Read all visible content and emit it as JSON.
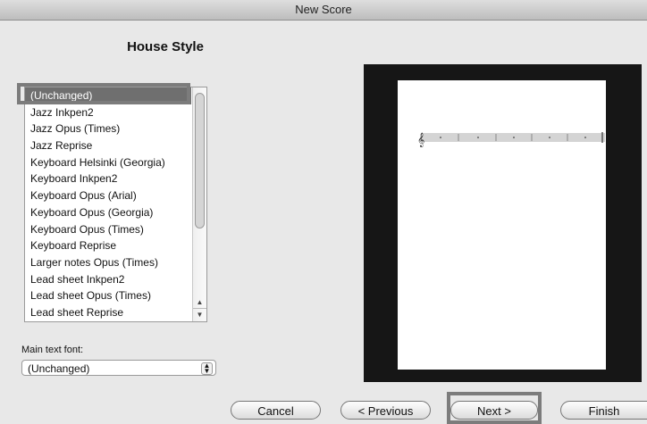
{
  "window": {
    "title": "New Score"
  },
  "section": {
    "heading": "House Style"
  },
  "house_styles": [
    "(Unchanged)",
    "Jazz Inkpen2",
    "Jazz Opus (Times)",
    "Jazz Reprise",
    "Keyboard Helsinki (Georgia)",
    "Keyboard Inkpen2",
    "Keyboard Opus (Arial)",
    "Keyboard Opus (Georgia)",
    "Keyboard Opus (Times)",
    "Keyboard Reprise",
    "Larger notes Opus (Times)",
    "Lead sheet Inkpen2",
    "Lead sheet Opus (Times)",
    "Lead sheet Reprise"
  ],
  "selected_style": "(Unchanged)",
  "main_text_font": {
    "label": "Main text font:",
    "value": "(Unchanged)"
  },
  "scrollbar": {
    "up_icon": "triangle-up",
    "down_icon": "triangle-down"
  },
  "preview": {
    "clef_icon": "treble-clef",
    "measures_shown": 5
  },
  "buttons": {
    "cancel": "Cancel",
    "previous": "< Previous",
    "next": "Next >",
    "finish": "Finish"
  },
  "colors": {
    "selection": "#6f6f6f",
    "preview_bg": "#161616"
  }
}
